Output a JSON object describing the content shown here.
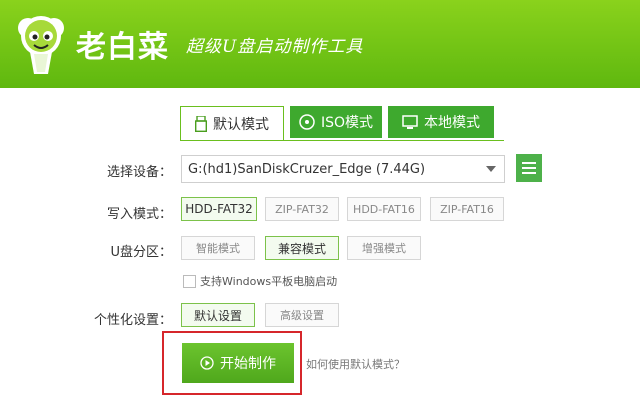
{
  "header": {
    "app_name": "老白菜",
    "slogan": "超级U盘启动制作工具",
    "logo_icon": "cabbage-mascot-icon"
  },
  "tabs": [
    {
      "label": "默认模式",
      "icon": "usb-drive-icon",
      "active": true
    },
    {
      "label": "ISO模式",
      "icon": "disc-icon",
      "active": false
    },
    {
      "label": "本地模式",
      "icon": "monitor-icon",
      "active": false
    }
  ],
  "device": {
    "label": "选择设备：",
    "value": "G:(hd1)SanDiskCruzer_Edge (7.44G)",
    "menu_icon": "hamburger-menu-icon"
  },
  "write_mode": {
    "label": "写入模式：",
    "options": [
      "HDD-FAT32",
      "ZIP-FAT32",
      "HDD-FAT16",
      "ZIP-FAT16"
    ],
    "selected": "HDD-FAT32"
  },
  "partition": {
    "label": "U盘分区：",
    "options": [
      "智能模式",
      "兼容模式",
      "增强模式"
    ],
    "selected": "兼容模式"
  },
  "windows_tablet": {
    "label": "支持Windows平板电脑启动",
    "checked": false
  },
  "personalize": {
    "label": "个性化设置：",
    "options": [
      "默认设置",
      "高级设置"
    ],
    "selected": "默认设置"
  },
  "start": {
    "label": "开始制作",
    "help_link": "如何使用默认模式？"
  },
  "colors": {
    "brand_green": "#5fb80f",
    "button_green": "#4fa81c",
    "highlight_red": "#d6262b"
  }
}
